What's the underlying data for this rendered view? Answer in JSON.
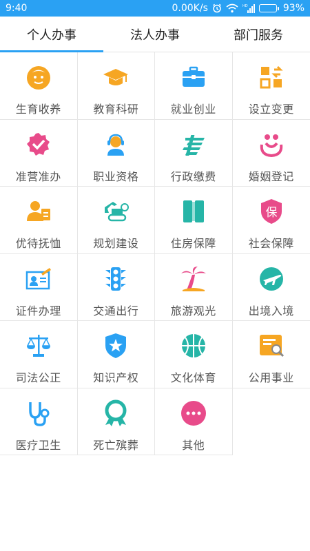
{
  "status_bar": {
    "time": "9:40",
    "net_speed": "0.00K/s",
    "battery": "93%",
    "battery_level": 0.93
  },
  "tabs": [
    {
      "label": "个人办事",
      "active": true
    },
    {
      "label": "法人办事",
      "active": false
    },
    {
      "label": "部门服务",
      "active": false
    }
  ],
  "grid": [
    {
      "label": "生育收养",
      "icon": "baby-icon",
      "color": "#f6a623"
    },
    {
      "label": "教育科研",
      "icon": "graduation-cap-icon",
      "color": "#f6a623"
    },
    {
      "label": "就业创业",
      "icon": "briefcase-icon",
      "color": "#2aa1f3"
    },
    {
      "label": "设立变更",
      "icon": "exchange-icon",
      "color": "#f6a623"
    },
    {
      "label": "准营准办",
      "icon": "approved-badge-icon",
      "color": "#e84b8a"
    },
    {
      "label": "职业资格",
      "icon": "customer-service-icon",
      "color": "#2aa1f3"
    },
    {
      "label": "行政缴费",
      "icon": "post-logo-icon",
      "color": "#26b5a7"
    },
    {
      "label": "婚姻登记",
      "icon": "marriage-icon",
      "color": "#e84b8a"
    },
    {
      "label": "优待抚恤",
      "icon": "person-card-icon",
      "color": "#f6a623"
    },
    {
      "label": "规划建设",
      "icon": "excavator-icon",
      "color": "#26b5a7"
    },
    {
      "label": "住房保障",
      "icon": "house-book-icon",
      "color": "#26b5a7"
    },
    {
      "label": "社会保障",
      "icon": "shield-bao-icon",
      "color": "#e84b8a"
    },
    {
      "label": "证件办理",
      "icon": "id-card-icon",
      "color": "#2aa1f3"
    },
    {
      "label": "交通出行",
      "icon": "traffic-light-icon",
      "color": "#2aa1f3"
    },
    {
      "label": "旅游观光",
      "icon": "palm-tree-icon",
      "color": "#e84b8a"
    },
    {
      "label": "出境入境",
      "icon": "airplane-icon",
      "color": "#26b5a7"
    },
    {
      "label": "司法公正",
      "icon": "scales-icon",
      "color": "#2aa1f3"
    },
    {
      "label": "知识产权",
      "icon": "star-shield-icon",
      "color": "#2aa1f3"
    },
    {
      "label": "文化体育",
      "icon": "basketball-icon",
      "color": "#26b5a7"
    },
    {
      "label": "公用事业",
      "icon": "search-document-icon",
      "color": "#f6a623"
    },
    {
      "label": "医疗卫生",
      "icon": "stethoscope-icon",
      "color": "#2aa1f3"
    },
    {
      "label": "死亡殡葬",
      "icon": "ribbon-wreath-icon",
      "color": "#26b5a7"
    },
    {
      "label": "其他",
      "icon": "more-icon",
      "color": "#e84b8a"
    }
  ]
}
